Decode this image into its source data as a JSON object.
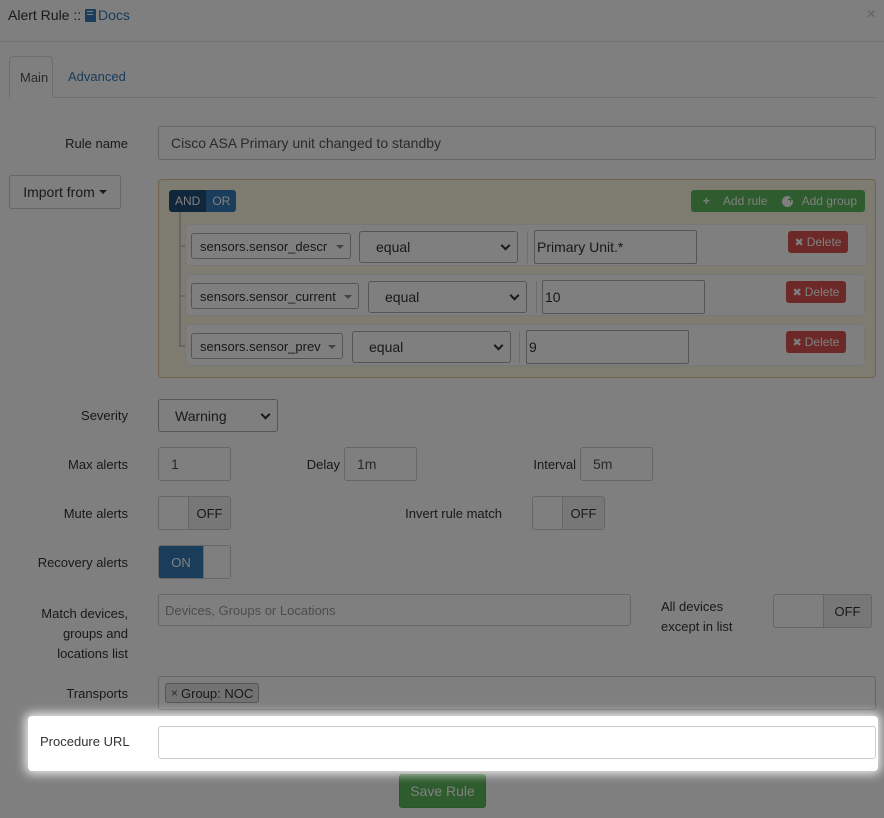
{
  "header": {
    "title_prefix": "Alert Rule :: ",
    "docs_label": "Docs",
    "close": "×"
  },
  "tabs": [
    {
      "label": "Main"
    },
    {
      "label": "Advanced"
    }
  ],
  "rule_name": {
    "label": "Rule name",
    "value": "Cisco ASA Primary unit changed to standby"
  },
  "import_from": {
    "label": "Import from"
  },
  "builder": {
    "and_label": "AND",
    "or_label": "OR",
    "add_rule_label": "Add rule",
    "add_group_label": "Add group",
    "delete_label": "Delete",
    "rules": [
      {
        "field": "sensors.sensor_descr",
        "operator": "equal",
        "value": "Primary Unit.*"
      },
      {
        "field": "sensors.sensor_current",
        "operator": "equal",
        "value": "10"
      },
      {
        "field": "sensors.sensor_prev",
        "operator": "equal",
        "value": "9"
      }
    ]
  },
  "severity": {
    "label": "Severity",
    "value": "Warning"
  },
  "max_alerts": {
    "label": "Max alerts",
    "value": "1"
  },
  "delay": {
    "label": "Delay",
    "value": "1m"
  },
  "interval": {
    "label": "Interval",
    "value": "5m"
  },
  "mute_alerts": {
    "label": "Mute alerts",
    "state": "OFF"
  },
  "invert_rule": {
    "label": "Invert rule match",
    "state": "OFF"
  },
  "recovery_alerts": {
    "label": "Recovery alerts",
    "state": "ON"
  },
  "match_devices": {
    "label_line1": "Match devices,",
    "label_line2": "groups and",
    "label_line3": "locations list",
    "placeholder": "Devices, Groups or Locations"
  },
  "all_devices": {
    "label_line1": "All devices",
    "label_line2": "except in list",
    "state": "OFF"
  },
  "transports": {
    "label": "Transports",
    "tag": "Group: NOC",
    "tag_remove": "×"
  },
  "procedure_url": {
    "label": "Procedure URL",
    "value": ""
  },
  "save_label": "Save Rule",
  "colors": {
    "primary": "#337ab7",
    "success": "#5cb85c",
    "danger": "#d9534f",
    "builder_bg": "#fcf8e3"
  }
}
